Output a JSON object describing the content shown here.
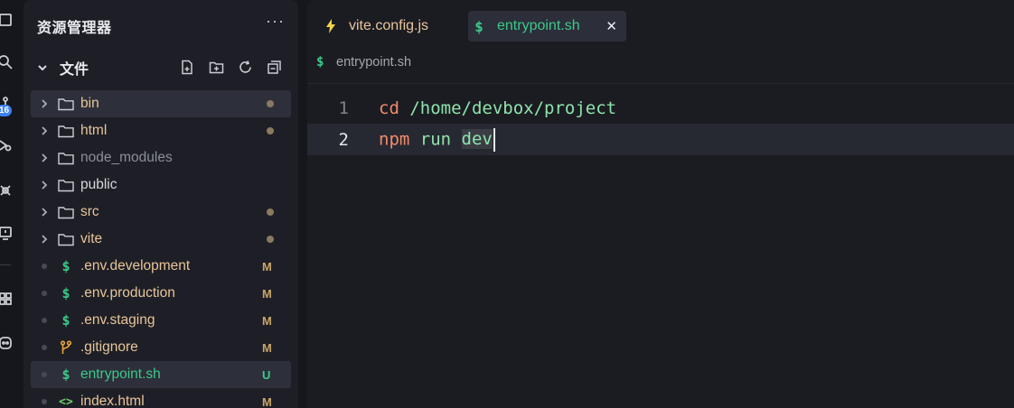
{
  "explorer": {
    "title": "资源管理器",
    "more": "···",
    "section_title": "文件",
    "items": [
      {
        "type": "folder",
        "name": "bin",
        "status": "dot",
        "color": "#e8c59a",
        "selected": true
      },
      {
        "type": "folder",
        "name": "html",
        "status": "dot",
        "color": "#e8c59a"
      },
      {
        "type": "folder",
        "name": "node_modules",
        "status": "",
        "color": "#8b8f98"
      },
      {
        "type": "folder",
        "name": "public",
        "status": "",
        "color": "#d5d8df"
      },
      {
        "type": "folder",
        "name": "src",
        "status": "dot",
        "color": "#e8c59a"
      },
      {
        "type": "folder",
        "name": "vite",
        "status": "dot",
        "color": "#e8c59a"
      },
      {
        "type": "shell",
        "name": ".env.development",
        "status": "M",
        "color": "#e8c59a"
      },
      {
        "type": "shell",
        "name": ".env.production",
        "status": "M",
        "color": "#e8c59a"
      },
      {
        "type": "shell",
        "name": ".env.staging",
        "status": "M",
        "color": "#e8c59a"
      },
      {
        "type": "git",
        "name": ".gitignore",
        "status": "M",
        "color": "#e8c59a"
      },
      {
        "type": "shell",
        "name": "entrypoint.sh",
        "status": "U",
        "color": "#3cc98a",
        "selected": true
      },
      {
        "type": "html",
        "name": "index.html",
        "status": "M",
        "color": "#e8c59a"
      }
    ]
  },
  "activity": {
    "badge": "16"
  },
  "tabs": [
    {
      "label": "vite.config.js",
      "icon": "lightning-icon",
      "active": false
    },
    {
      "label": "entrypoint.sh",
      "icon": "dollar-icon",
      "active": true,
      "close": "✕"
    }
  ],
  "breadcrumb": {
    "icon": "$",
    "label": "entrypoint.sh"
  },
  "code": {
    "line1_num": "1",
    "line2_num": "2",
    "line1_cmd": "cd",
    "line1_arg": " /home/devbox/project",
    "line2_cmd": "npm",
    "line2_mid": " run ",
    "line2_sel": "dev"
  },
  "colors": {
    "folder_modified": "#e8c59a",
    "untracked": "#3cc98a",
    "keyword": "#f28a6a",
    "string": "#8fe3ac"
  }
}
